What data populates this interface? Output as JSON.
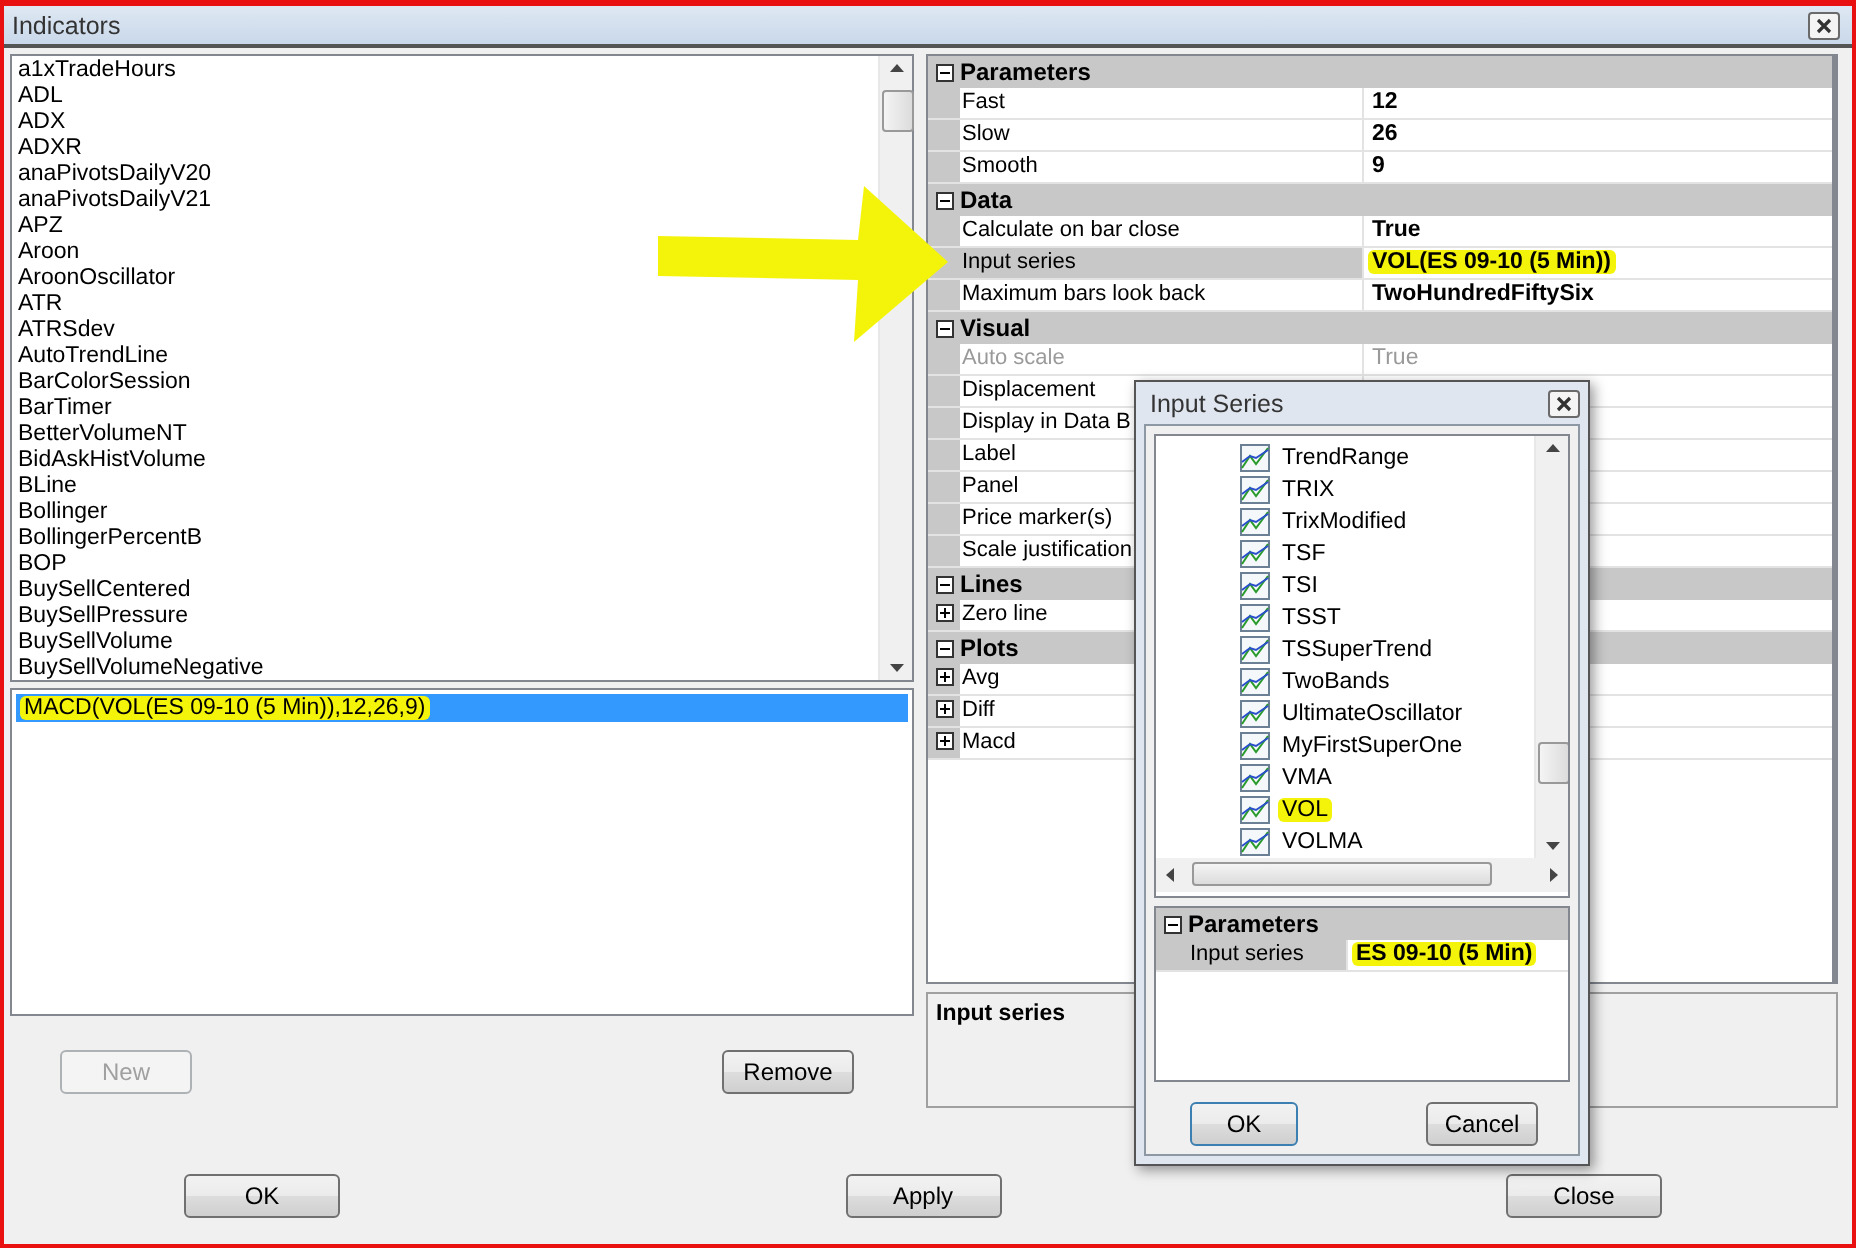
{
  "window": {
    "title": "Indicators"
  },
  "indicator_list": {
    "items": [
      "a1xTradeHours",
      "ADL",
      "ADX",
      "ADXR",
      "anaPivotsDailyV20",
      "anaPivotsDailyV21",
      "APZ",
      "Aroon",
      "AroonOscillator",
      "ATR",
      "ATRSdev",
      "AutoTrendLine",
      "BarColorSession",
      "BarTimer",
      "BetterVolumeNT",
      "BidAskHistVolume",
      "BLine",
      "Bollinger",
      "BollingerPercentB",
      "BOP",
      "BuySellCentered",
      "BuySellPressure",
      "BuySellVolume",
      "BuySellVolumeNegative"
    ]
  },
  "applied_list": {
    "items": [
      {
        "label": "MACD(VOL(ES 09-10 (5 Min)),12,26,9)",
        "selected": true,
        "highlighted": true
      }
    ]
  },
  "left_buttons": [
    {
      "label": "New",
      "disabled": true
    },
    {
      "label": "Remove",
      "disabled": false
    }
  ],
  "properties": {
    "categories": [
      {
        "name": "Parameters",
        "expanded": true,
        "rows": [
          {
            "name": "Fast",
            "value": "12",
            "selected": false,
            "disabled": false
          },
          {
            "name": "Slow",
            "value": "26",
            "selected": false,
            "disabled": false
          },
          {
            "name": "Smooth",
            "value": "9",
            "selected": false,
            "disabled": false
          }
        ]
      },
      {
        "name": "Data",
        "expanded": true,
        "rows": [
          {
            "name": "Calculate on bar close",
            "value": "True",
            "selected": false,
            "disabled": false
          },
          {
            "name": "Input series",
            "value": "VOL(ES 09-10 (5 Min))",
            "selected": true,
            "disabled": false,
            "highlighted": true
          },
          {
            "name": "Maximum bars look back",
            "value": "TwoHundredFiftySix",
            "selected": false,
            "disabled": false
          }
        ]
      },
      {
        "name": "Visual",
        "expanded": true,
        "rows": [
          {
            "name": "Auto scale",
            "value": "True",
            "selected": false,
            "disabled": true
          },
          {
            "name": "Displacement",
            "selected": false,
            "disabled": false
          },
          {
            "name": "Display in Data B",
            "selected": false,
            "disabled": false
          },
          {
            "name": "Label",
            "selected": false,
            "disabled": false
          },
          {
            "name": "Panel",
            "selected": false,
            "disabled": false
          },
          {
            "name": "Price marker(s)",
            "selected": false,
            "disabled": false
          },
          {
            "name": "Scale justification",
            "selected": false,
            "disabled": false
          }
        ]
      },
      {
        "name": "Lines",
        "expanded": true,
        "rows": [
          {
            "name": "Zero line",
            "selected": false,
            "disabled": false,
            "expanded": false
          }
        ]
      },
      {
        "name": "Plots",
        "expanded": true,
        "rows": [
          {
            "name": "Avg",
            "selected": false,
            "disabled": false,
            "expanded": false
          },
          {
            "name": "Diff",
            "selected": false,
            "disabled": false,
            "expanded": false
          },
          {
            "name": "Macd",
            "selected": false,
            "disabled": false,
            "expanded": false
          }
        ]
      }
    ]
  },
  "description": {
    "title": "Input series"
  },
  "dialog_buttons": [
    "OK",
    "Apply",
    "Close"
  ],
  "input_series_dialog": {
    "title": "Input Series",
    "items": [
      {
        "label": "TrendRange",
        "highlighted": false
      },
      {
        "label": "TRIX",
        "highlighted": false
      },
      {
        "label": "TrixModified",
        "highlighted": false
      },
      {
        "label": "TSF",
        "highlighted": false
      },
      {
        "label": "TSI",
        "highlighted": false
      },
      {
        "label": "TSST",
        "highlighted": false
      },
      {
        "label": "TSSuperTrend",
        "highlighted": false
      },
      {
        "label": "TwoBands",
        "highlighted": false
      },
      {
        "label": "UltimateOscillator",
        "highlighted": false
      },
      {
        "label": "MyFirstSuperOne",
        "highlighted": false
      },
      {
        "label": "VMA",
        "highlighted": false
      },
      {
        "label": "VOL",
        "highlighted": true
      },
      {
        "label": "VOLMA",
        "highlighted": false
      }
    ],
    "parameters": {
      "name": "Parameters",
      "expanded": true,
      "rows": [
        {
          "name": "Input series",
          "value": "ES 09-10 (5 Min)",
          "selected": true,
          "disabled": false,
          "highlighted": true
        }
      ]
    },
    "buttons": [
      {
        "label": "OK",
        "default": true
      },
      {
        "label": "Cancel",
        "default": false
      }
    ]
  },
  "annotation": {
    "kind": "arrow"
  }
}
